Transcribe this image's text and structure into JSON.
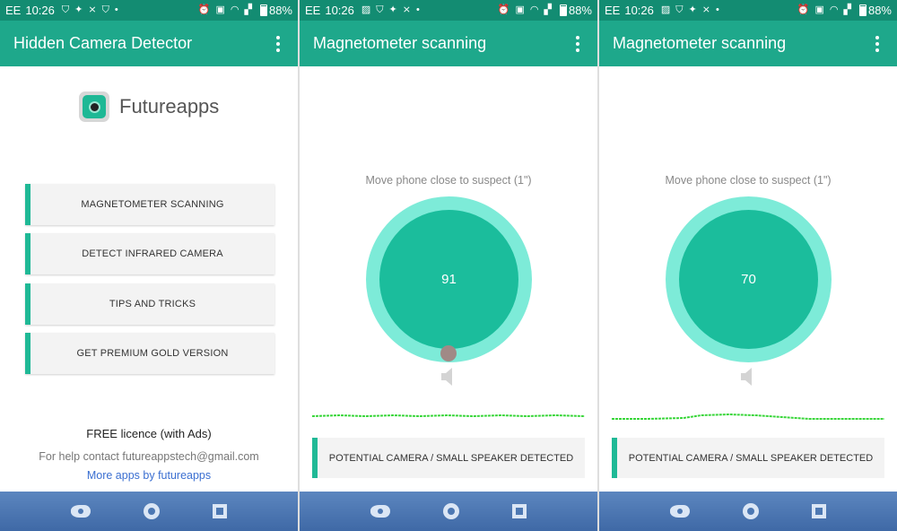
{
  "status_bar": {
    "carrier": "EE",
    "time": "10:26",
    "battery": "88%"
  },
  "screens": [
    {
      "title": "Hidden Camera Detector",
      "brand": "Futureapps",
      "menu": [
        "MAGNETOMETER SCANNING",
        "DETECT INFRARED CAMERA",
        "TIPS AND TRICKS",
        "GET PREMIUM GOLD VERSION"
      ],
      "licence": "FREE licence (with Ads)",
      "help": "For help contact futureappstech@gmail.com",
      "more_apps": "More apps by futureapps"
    },
    {
      "title": "Magnetometer scanning",
      "instruction": "Move phone close to suspect (1\")",
      "reading": "91",
      "status": "POTENTIAL CAMERA / SMALL SPEAKER DETECTED"
    },
    {
      "title": "Magnetometer scanning",
      "instruction": "Move phone close to suspect (1\")",
      "reading": "70",
      "status": "POTENTIAL CAMERA / SMALL SPEAKER DETECTED"
    }
  ],
  "icons": {
    "overflow": "more-vert-icon",
    "speaker": "speaker-icon",
    "back": "back-icon",
    "home": "home-icon",
    "recent": "recent-apps-icon"
  },
  "colors": {
    "app_bar": "#1ea88b",
    "status_bar": "#138c72",
    "gauge_outer": "#7debd8",
    "gauge_inner": "#1bbd9c",
    "accent": "#1fb996",
    "nav_bar": "#4d78b3",
    "link": "#3b6fd1",
    "wave": "#39d63a"
  }
}
